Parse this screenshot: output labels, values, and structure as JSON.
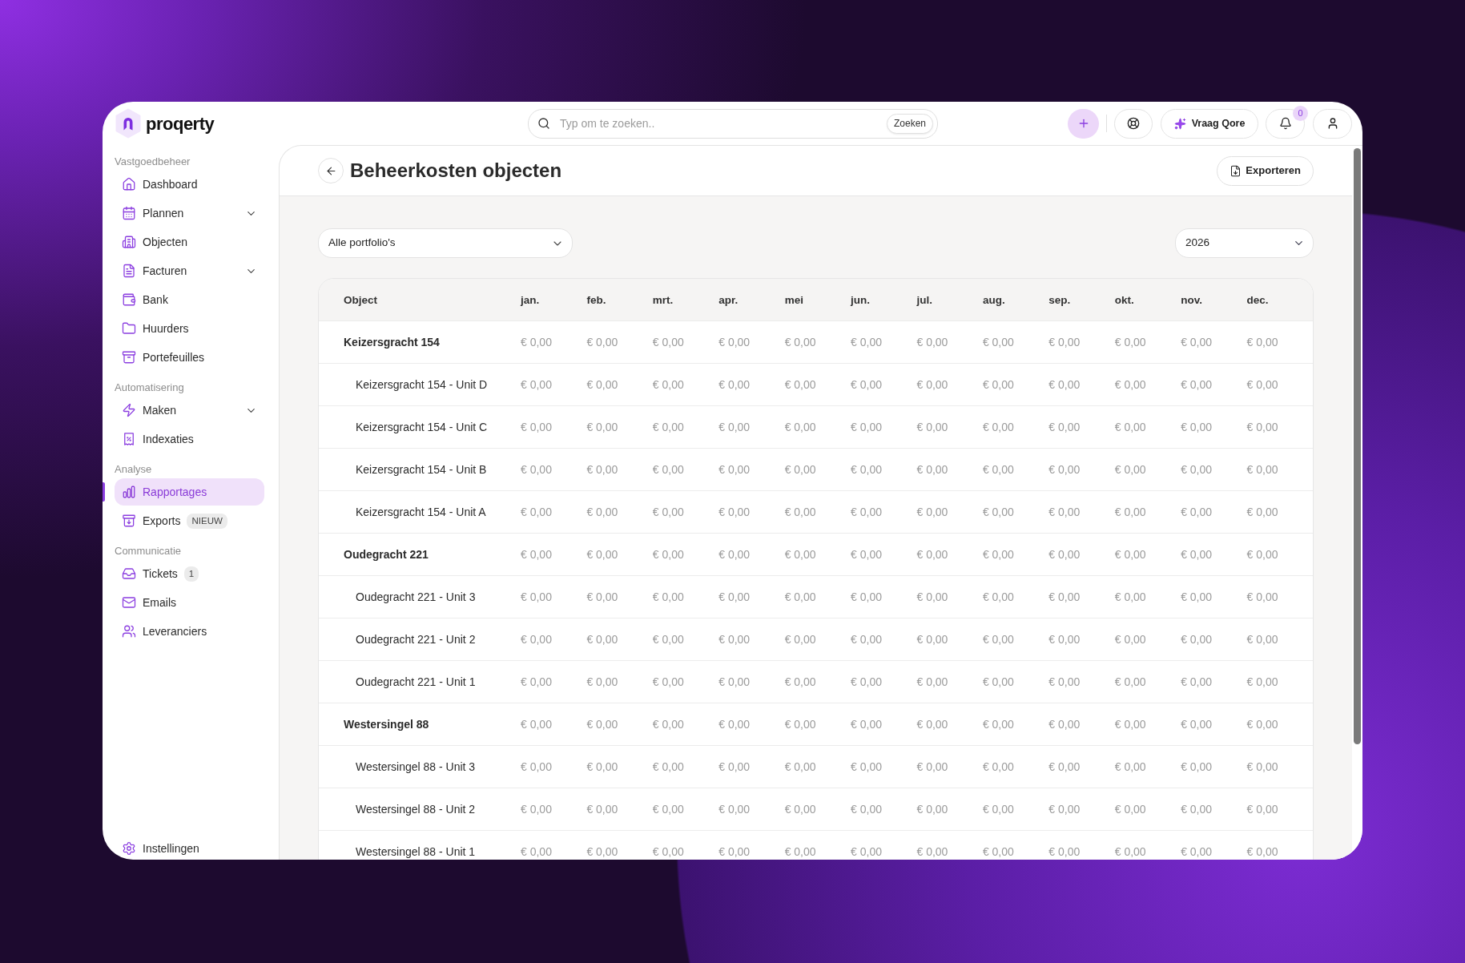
{
  "top_bar": {
    "logo": {
      "text": "proqerty"
    },
    "search": {
      "placeholder": "Typ om te zoeken..",
      "button": "Zoeken"
    },
    "ask_button": "Vraag Qore",
    "notifications": {
      "badge": "0"
    }
  },
  "sidebar": {
    "sections": [
      {
        "title": "Vastgoedbeheer",
        "items": [
          {
            "label": "Dashboard",
            "selected": false,
            "expandable": false
          },
          {
            "label": "Plannen",
            "selected": false,
            "expandable": true
          },
          {
            "label": "Objecten",
            "selected": false,
            "expandable": false
          },
          {
            "label": "Facturen",
            "selected": false,
            "expandable": true
          },
          {
            "label": "Bank",
            "selected": false,
            "expandable": false
          },
          {
            "label": "Huurders",
            "selected": false,
            "expandable": false
          },
          {
            "label": "Portefeuilles",
            "selected": false,
            "expandable": false
          }
        ]
      },
      {
        "title": "Automatisering",
        "items": [
          {
            "label": "Maken",
            "selected": false,
            "expandable": true
          },
          {
            "label": "Indexaties",
            "selected": false,
            "expandable": false
          }
        ]
      },
      {
        "title": "Analyse",
        "items": [
          {
            "label": "Rapportages",
            "selected": true,
            "expandable": false
          },
          {
            "label": "Exports",
            "selected": false,
            "expandable": false,
            "badge": "NIEUW"
          }
        ]
      },
      {
        "title": "Communicatie",
        "items": [
          {
            "label": "Tickets",
            "selected": false,
            "expandable": false,
            "badge": "1"
          },
          {
            "label": "Emails",
            "selected": false,
            "expandable": false
          },
          {
            "label": "Leveranciers",
            "selected": false,
            "expandable": false
          }
        ]
      }
    ],
    "footer_item": {
      "label": "Instellingen",
      "selected": false
    }
  },
  "page": {
    "title": "Beheerkosten objecten",
    "export_button": "Exporteren",
    "portfolio_select": {
      "value": "Alle portfolio's"
    },
    "year_select": {
      "value": "2026"
    }
  },
  "table": {
    "columns": [
      "Object",
      "jan.",
      "feb.",
      "mrt.",
      "apr.",
      "mei",
      "jun.",
      "jul.",
      "aug.",
      "sep.",
      "okt.",
      "nov.",
      "dec."
    ],
    "rows": [
      {
        "object": "Keizersgracht 154",
        "values": [
          "€ 0,00",
          "€ 0,00",
          "€ 0,00",
          "€ 0,00",
          "€ 0,00",
          "€ 0,00",
          "€ 0,00",
          "€ 0,00",
          "€ 0,00",
          "€ 0,00",
          "€ 0,00",
          "€ 0,00"
        ],
        "children": [
          {
            "object": "Keizersgracht 154 - Unit D",
            "values": [
              "€ 0,00",
              "€ 0,00",
              "€ 0,00",
              "€ 0,00",
              "€ 0,00",
              "€ 0,00",
              "€ 0,00",
              "€ 0,00",
              "€ 0,00",
              "€ 0,00",
              "€ 0,00",
              "€ 0,00"
            ]
          },
          {
            "object": "Keizersgracht 154 - Unit C",
            "values": [
              "€ 0,00",
              "€ 0,00",
              "€ 0,00",
              "€ 0,00",
              "€ 0,00",
              "€ 0,00",
              "€ 0,00",
              "€ 0,00",
              "€ 0,00",
              "€ 0,00",
              "€ 0,00",
              "€ 0,00"
            ]
          },
          {
            "object": "Keizersgracht 154 - Unit B",
            "values": [
              "€ 0,00",
              "€ 0,00",
              "€ 0,00",
              "€ 0,00",
              "€ 0,00",
              "€ 0,00",
              "€ 0,00",
              "€ 0,00",
              "€ 0,00",
              "€ 0,00",
              "€ 0,00",
              "€ 0,00"
            ]
          },
          {
            "object": "Keizersgracht 154 - Unit A",
            "values": [
              "€ 0,00",
              "€ 0,00",
              "€ 0,00",
              "€ 0,00",
              "€ 0,00",
              "€ 0,00",
              "€ 0,00",
              "€ 0,00",
              "€ 0,00",
              "€ 0,00",
              "€ 0,00",
              "€ 0,00"
            ]
          }
        ]
      },
      {
        "object": "Oudegracht 221",
        "values": [
          "€ 0,00",
          "€ 0,00",
          "€ 0,00",
          "€ 0,00",
          "€ 0,00",
          "€ 0,00",
          "€ 0,00",
          "€ 0,00",
          "€ 0,00",
          "€ 0,00",
          "€ 0,00",
          "€ 0,00"
        ],
        "children": [
          {
            "object": "Oudegracht 221 - Unit 3",
            "values": [
              "€ 0,00",
              "€ 0,00",
              "€ 0,00",
              "€ 0,00",
              "€ 0,00",
              "€ 0,00",
              "€ 0,00",
              "€ 0,00",
              "€ 0,00",
              "€ 0,00",
              "€ 0,00",
              "€ 0,00"
            ]
          },
          {
            "object": "Oudegracht 221 - Unit 2",
            "values": [
              "€ 0,00",
              "€ 0,00",
              "€ 0,00",
              "€ 0,00",
              "€ 0,00",
              "€ 0,00",
              "€ 0,00",
              "€ 0,00",
              "€ 0,00",
              "€ 0,00",
              "€ 0,00",
              "€ 0,00"
            ]
          },
          {
            "object": "Oudegracht 221 - Unit 1",
            "values": [
              "€ 0,00",
              "€ 0,00",
              "€ 0,00",
              "€ 0,00",
              "€ 0,00",
              "€ 0,00",
              "€ 0,00",
              "€ 0,00",
              "€ 0,00",
              "€ 0,00",
              "€ 0,00",
              "€ 0,00"
            ]
          }
        ]
      },
      {
        "object": "Westersingel 88",
        "values": [
          "€ 0,00",
          "€ 0,00",
          "€ 0,00",
          "€ 0,00",
          "€ 0,00",
          "€ 0,00",
          "€ 0,00",
          "€ 0,00",
          "€ 0,00",
          "€ 0,00",
          "€ 0,00",
          "€ 0,00"
        ],
        "children": [
          {
            "object": "Westersingel 88 - Unit 3",
            "values": [
              "€ 0,00",
              "€ 0,00",
              "€ 0,00",
              "€ 0,00",
              "€ 0,00",
              "€ 0,00",
              "€ 0,00",
              "€ 0,00",
              "€ 0,00",
              "€ 0,00",
              "€ 0,00",
              "€ 0,00"
            ]
          },
          {
            "object": "Westersingel 88 - Unit 2",
            "values": [
              "€ 0,00",
              "€ 0,00",
              "€ 0,00",
              "€ 0,00",
              "€ 0,00",
              "€ 0,00",
              "€ 0,00",
              "€ 0,00",
              "€ 0,00",
              "€ 0,00",
              "€ 0,00",
              "€ 0,00"
            ]
          },
          {
            "object": "Westersingel 88 - Unit 1",
            "values": [
              "€ 0,00",
              "€ 0,00",
              "€ 0,00",
              "€ 0,00",
              "€ 0,00",
              "€ 0,00",
              "€ 0,00",
              "€ 0,00",
              "€ 0,00",
              "€ 0,00",
              "€ 0,00",
              "€ 0,00"
            ]
          }
        ]
      }
    ]
  }
}
